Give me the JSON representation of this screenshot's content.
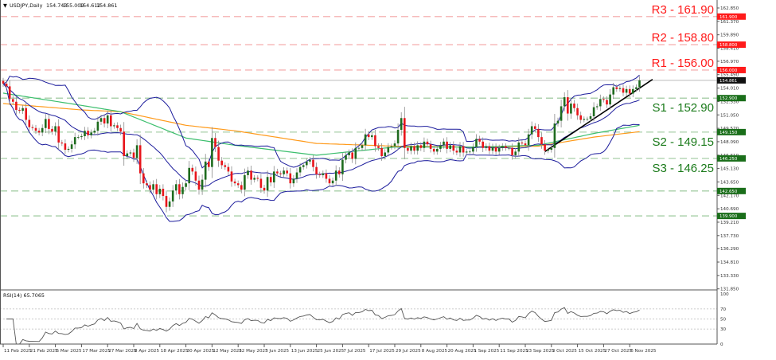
{
  "header": {
    "symbol": "USDJPY,Daily",
    "open": "154.743",
    "high": "155.009",
    "low": "154.612",
    "close": "154.861",
    "menu_icon": "triangle-down-icon"
  },
  "rsi_label": "RSI(14) 65.7065",
  "colors": {
    "bull": "#1e6b1e",
    "bear": "#e8141a",
    "wick": "#8a8a8a",
    "bollinger": "#1c1c9c",
    "ma_fast": "#3dbf6e",
    "ma_slow": "#ff9a1a",
    "resistance": "#ff1a1a",
    "support": "#1a7a1a",
    "trendline": "#000000",
    "rsi": "#555555"
  },
  "chart_data": [
    {
      "type": "candlestick",
      "title": "",
      "start_date": "2025-02-11",
      "ylim": [
        131.85,
        162.85
      ],
      "y_ticks": [
        "162.850",
        "161.370",
        "159.890",
        "158.410",
        "156.970",
        "155.490",
        "154.010",
        "152.530",
        "151.050",
        "149.570",
        "148.090",
        "146.610",
        "145.130",
        "143.650",
        "142.170",
        "140.690",
        "139.210",
        "137.730",
        "136.290",
        "134.810",
        "133.330",
        "131.850"
      ],
      "x_ticks": [
        {
          "label": "11 Feb 2025",
          "date": "2025-02-11"
        },
        {
          "label": "21 Feb 2025",
          "date": "2025-02-21"
        },
        {
          "label": "5 Mar 2025",
          "date": "2025-03-05"
        },
        {
          "label": "17 Mar 2025",
          "date": "2025-03-17"
        },
        {
          "label": "27 Mar 2025",
          "date": "2025-03-27"
        },
        {
          "label": "8 Apr 2025",
          "date": "2025-04-08"
        },
        {
          "label": "18 Apr 2025",
          "date": "2025-04-18"
        },
        {
          "label": "30 Apr 2025",
          "date": "2025-04-30"
        },
        {
          "label": "12 May 2025",
          "date": "2025-05-12"
        },
        {
          "label": "22 May 2025",
          "date": "2025-05-22"
        },
        {
          "label": "3 Jun 2025",
          "date": "2025-06-03"
        },
        {
          "label": "13 Jun 2025",
          "date": "2025-06-13"
        },
        {
          "label": "25 Jun 2025",
          "date": "2025-06-25"
        },
        {
          "label": "7 Jul 2025",
          "date": "2025-07-07"
        },
        {
          "label": "17 Jul 2025",
          "date": "2025-07-17"
        },
        {
          "label": "29 Jul 2025",
          "date": "2025-07-29"
        },
        {
          "label": "8 Aug 2025",
          "date": "2025-08-08"
        },
        {
          "label": "20 Aug 2025",
          "date": "2025-08-20"
        },
        {
          "label": "1 Sep 2025",
          "date": "2025-09-01"
        },
        {
          "label": "11 Sep 2025",
          "date": "2025-09-11"
        },
        {
          "label": "23 Sep 2025",
          "date": "2025-09-23"
        },
        {
          "label": "3 Oct 2025",
          "date": "2025-10-03"
        },
        {
          "label": "15 Oct 2025",
          "date": "2025-10-15"
        },
        {
          "label": "27 Oct 2025",
          "date": "2025-10-27"
        },
        {
          "label": "6 Nov 2025",
          "date": "2025-11-06"
        }
      ],
      "closes": [
        154.5,
        154.2,
        152.8,
        152.5,
        151.6,
        151.5,
        151.8,
        150.5,
        149.7,
        149.6,
        149.3,
        149.1,
        149.6,
        150.6,
        149.5,
        149.2,
        149.8,
        148.0,
        147.9,
        147.2,
        147.3,
        147.8,
        148.6,
        148.6,
        148.7,
        149.3,
        148.8,
        149.1,
        149.3,
        150.3,
        150.7,
        150.1,
        151.0,
        149.8,
        149.9,
        149.6,
        149.2,
        146.5,
        146.8,
        146.9,
        146.3,
        147.7,
        144.6,
        143.5,
        143.3,
        142.8,
        143.4,
        142.3,
        142.9,
        142.1,
        140.9,
        141.5,
        142.7,
        143.4,
        142.3,
        143.1,
        143.5,
        145.2,
        144.8,
        143.8,
        142.8,
        143.9,
        145.9,
        145.3,
        148.5,
        147.5,
        146.0,
        145.5,
        145.3,
        144.8,
        143.7,
        143.5,
        143.3,
        142.8,
        144.4,
        144.9,
        143.9,
        144.1,
        144.0,
        143.0,
        142.7,
        144.2,
        143.6,
        144.8,
        144.6,
        144.5,
        144.9,
        144.6,
        143.5,
        144.0,
        144.7,
        145.3,
        145.5,
        145.9,
        146.1,
        145.3,
        144.5,
        144.4,
        144.6,
        144.0,
        143.5,
        143.8,
        144.9,
        144.5,
        146.1,
        146.6,
        146.9,
        146.2,
        147.4,
        147.4,
        147.7,
        148.9,
        148.6,
        148.8,
        147.6,
        147.4,
        146.5,
        146.9,
        147.5,
        147.6,
        147.9,
        149.4,
        150.7,
        147.4,
        147.1,
        147.6,
        147.1,
        147.7,
        147.4,
        148.1,
        147.8,
        147.3,
        147.0,
        147.3,
        147.7,
        148.1,
        147.3,
        147.7,
        147.1,
        146.9,
        147.6,
        146.9,
        147.0,
        147.0,
        147.5,
        148.4,
        148.1,
        147.4,
        147.6,
        147.1,
        147.5,
        147.0,
        147.4,
        147.6,
        147.4,
        147.4,
        146.6,
        147.0,
        148.0,
        147.9,
        147.7,
        148.9,
        149.8,
        149.5,
        148.6,
        147.8,
        147.1,
        147.2,
        147.4,
        150.1,
        150.4,
        152.0,
        153.0,
        151.2,
        152.3,
        151.8,
        151.0,
        150.5,
        150.6,
        150.6,
        150.9,
        151.9,
        152.0,
        152.8,
        152.7,
        152.2,
        153.3,
        154.1,
        153.9,
        154.0,
        153.5,
        153.9,
        153.4,
        153.9,
        154.1,
        154.861
      ],
      "ma_fast": [
        [
          "2025-02-11",
          153.45
        ],
        [
          "2025-03-17",
          152.1
        ],
        [
          "2025-04-02",
          151.4
        ],
        [
          "2025-04-30",
          148.5
        ],
        [
          "2025-05-21",
          147.7
        ],
        [
          "2025-06-25",
          146.6
        ],
        [
          "2025-07-29",
          147.5
        ],
        [
          "2025-09-01",
          147.5
        ],
        [
          "2025-09-29",
          147.7
        ],
        [
          "2025-10-22",
          149.0
        ],
        [
          "2025-11-11",
          149.9
        ]
      ],
      "ma_slow": [
        [
          "2025-02-11",
          152.3
        ],
        [
          "2025-03-17",
          151.6
        ],
        [
          "2025-04-02",
          151.4
        ],
        [
          "2025-04-30",
          149.9
        ],
        [
          "2025-05-21",
          149.3
        ],
        [
          "2025-06-25",
          147.9
        ],
        [
          "2025-07-29",
          147.6
        ],
        [
          "2025-09-01",
          147.5
        ],
        [
          "2025-09-29",
          147.6
        ],
        [
          "2025-10-22",
          148.6
        ],
        [
          "2025-11-11",
          149.2
        ]
      ],
      "bollinger": {
        "period": 20,
        "stddev": 2
      },
      "trendline": [
        [
          "2025-10-01",
          147.0
        ],
        [
          "2025-11-11",
          154.0
        ]
      ],
      "current_price": {
        "value": 154.861,
        "tag": "154.861"
      },
      "levels": [
        {
          "name": "R3",
          "value": 161.9,
          "label": "R3 - 161.90",
          "tag": "161.900",
          "kind": "resistance"
        },
        {
          "name": "R2",
          "value": 158.8,
          "label": "R2 - 158.80",
          "tag": "158.800",
          "kind": "resistance"
        },
        {
          "name": "R1",
          "value": 156.0,
          "label": "R1 - 156.00",
          "tag": "156.000",
          "kind": "resistance"
        },
        {
          "name": "S1",
          "value": 152.9,
          "label": "S1 - 152.90",
          "tag": "152.900",
          "kind": "support"
        },
        {
          "name": "S2",
          "value": 149.15,
          "label": "S2 - 149.15",
          "tag": "149.150",
          "kind": "support"
        },
        {
          "name": "S3",
          "value": 146.25,
          "label": "S3 - 146.25",
          "tag": "146.250",
          "kind": "support"
        },
        {
          "name": "",
          "value": 142.65,
          "label": "",
          "tag": "142.650",
          "kind": "support"
        },
        {
          "name": "",
          "value": 139.9,
          "label": "",
          "tag": "139.900",
          "kind": "support"
        }
      ]
    },
    {
      "type": "line",
      "title": "RSI(14) 65.7065",
      "period": 14,
      "ylim": [
        0,
        100
      ],
      "y_ticks": [
        "100",
        "70",
        "50",
        "30",
        "0"
      ],
      "levels": [
        70,
        50,
        30
      ]
    }
  ]
}
